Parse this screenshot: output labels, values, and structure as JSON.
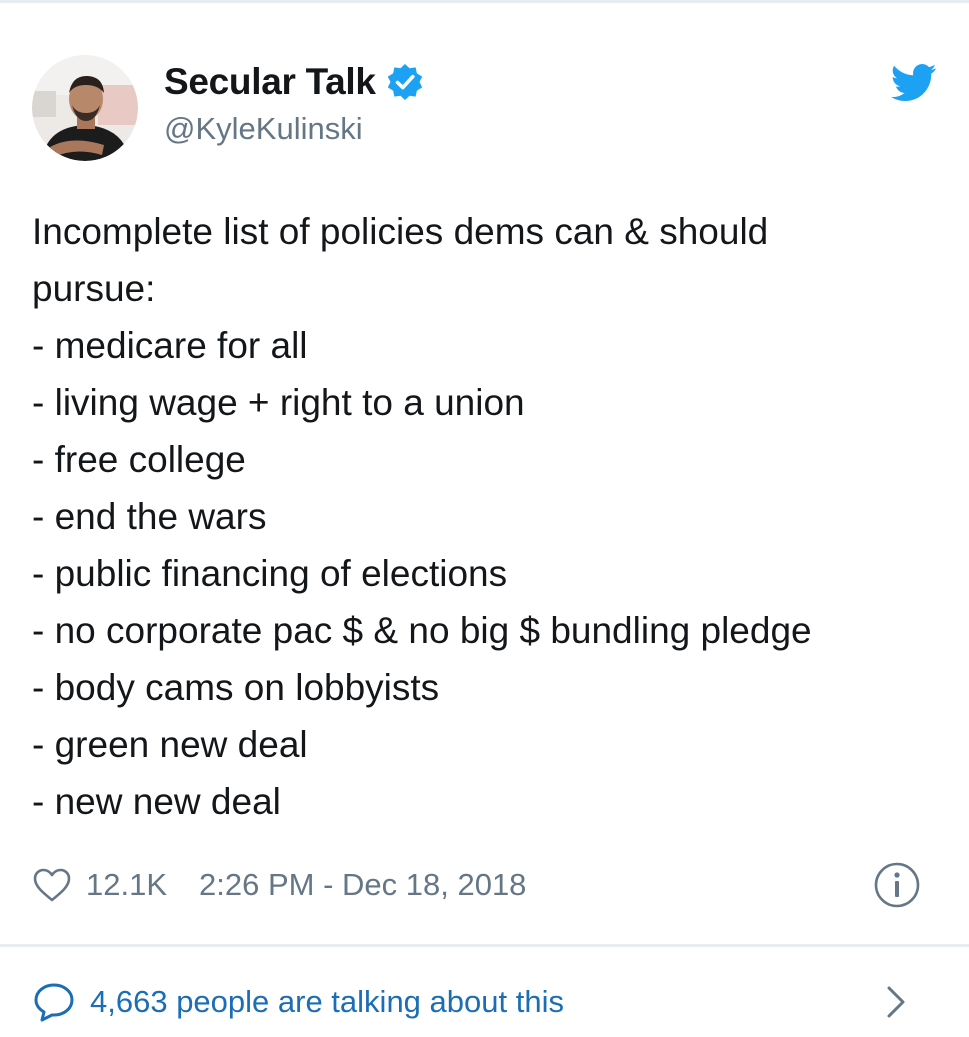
{
  "author": {
    "display_name": "Secular Talk",
    "handle": "@KyleKulinski",
    "verified": true,
    "avatar_icon": "avatar-photo"
  },
  "tweet": {
    "lines": [
      "Incomplete list of policies dems can & should",
      "pursue:",
      "- medicare for all",
      "- living wage + right to a union",
      "- free college",
      "- end the wars",
      "- public financing of elections",
      "- no corporate pac $ & no big $ bundling pledge",
      "- body cams on lobbyists",
      "- green new deal",
      "- new new deal"
    ]
  },
  "meta": {
    "likes": "12.1K",
    "timestamp": "2:26 PM - Dec 18, 2018"
  },
  "conversation": {
    "label": "4,663 people are talking about this"
  },
  "colors": {
    "text": "#14171a",
    "secondary": "#657786",
    "twitter_blue": "#1da1f2",
    "link": "#1b6eb5",
    "divider": "#e6ecf0"
  },
  "icons": {
    "brand": "twitter-bird-icon",
    "verified": "verified-badge-icon",
    "like": "heart-icon",
    "info": "info-icon",
    "conversation": "speech-bubble-icon",
    "chevron": "chevron-right-icon"
  }
}
